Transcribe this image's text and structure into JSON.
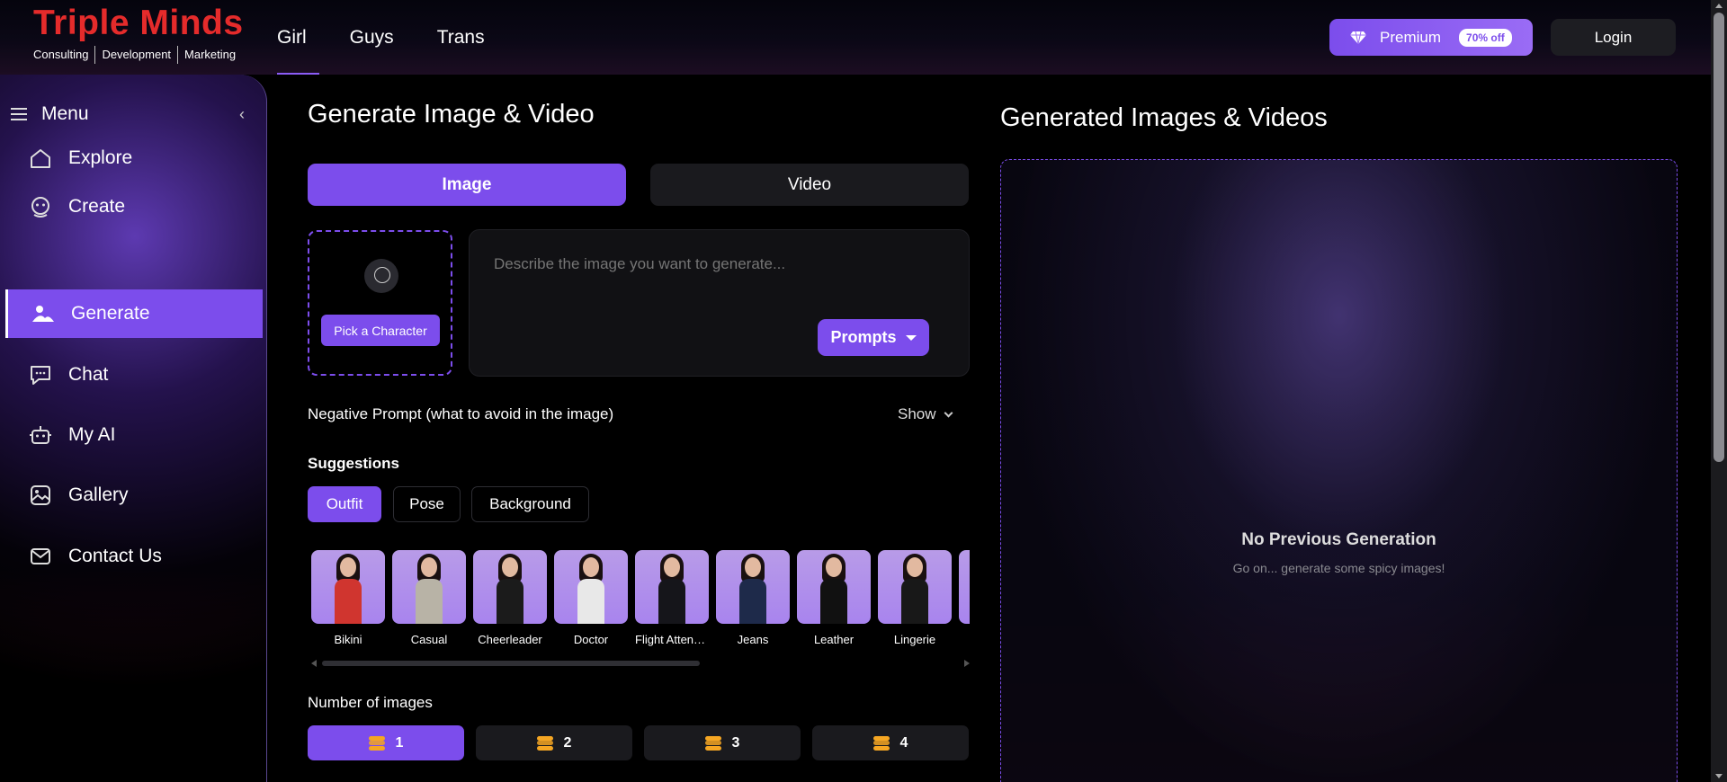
{
  "brand": {
    "name": "Triple Minds",
    "tags": [
      "Consulting",
      "Development",
      "Marketing"
    ],
    "color": "#e52b2b"
  },
  "topnav": {
    "items": [
      {
        "label": "Girl",
        "active": true
      },
      {
        "label": "Guys",
        "active": false
      },
      {
        "label": "Trans",
        "active": false
      }
    ]
  },
  "header": {
    "premium_label": "Premium",
    "premium_badge": "70% off",
    "login_label": "Login"
  },
  "sidebar": {
    "menu_label": "Menu",
    "items": [
      {
        "label": "Explore",
        "icon": "home-icon",
        "active": false
      },
      {
        "label": "Create",
        "icon": "create-icon",
        "active": false
      },
      {
        "label": "Generate",
        "icon": "generate-icon",
        "active": true
      },
      {
        "label": "Chat",
        "icon": "chat-icon",
        "active": false
      },
      {
        "label": "My AI",
        "icon": "robot-icon",
        "active": false
      },
      {
        "label": "Gallery",
        "icon": "gallery-icon",
        "active": false
      },
      {
        "label": "Contact Us",
        "icon": "mail-icon",
        "active": false
      }
    ]
  },
  "main": {
    "title": "Generate Image & Video",
    "tabs": [
      {
        "label": "Image",
        "active": true
      },
      {
        "label": "Video",
        "active": false
      }
    ],
    "pick_character_label": "Pick a Character",
    "prompt_placeholder": "Describe the image you want to generate...",
    "prompts_button": "Prompts",
    "negative_prompt_label": "Negative Prompt (what to avoid in the image)",
    "negative_prompt_toggle": "Show",
    "suggestions_label": "Suggestions",
    "suggestion_chips": [
      {
        "label": "Outfit",
        "active": true
      },
      {
        "label": "Pose",
        "active": false
      },
      {
        "label": "Background",
        "active": false
      }
    ],
    "outfits": [
      {
        "label": "Bikini",
        "color": "#d0352f"
      },
      {
        "label": "Casual",
        "color": "#b8b3a6"
      },
      {
        "label": "Cheerleader",
        "color": "#1b1b1b"
      },
      {
        "label": "Doctor",
        "color": "#e8e8e8"
      },
      {
        "label": "Flight Attendant",
        "color": "#15151a"
      },
      {
        "label": "Jeans",
        "color": "#1e2a4a"
      },
      {
        "label": "Leather",
        "color": "#111111"
      },
      {
        "label": "Lingerie",
        "color": "#181818"
      }
    ],
    "number_of_images_label": "Number of images",
    "number_options": [
      {
        "label": "1",
        "active": true
      },
      {
        "label": "2",
        "active": false
      },
      {
        "label": "3",
        "active": false
      },
      {
        "label": "4",
        "active": false
      }
    ]
  },
  "right": {
    "title": "Generated Images & Videos",
    "empty_title": "No Previous Generation",
    "empty_subtitle": "Go on... generate some spicy images!"
  },
  "colors": {
    "accent": "#7c4dec",
    "stack_icon": "#f5a623"
  }
}
